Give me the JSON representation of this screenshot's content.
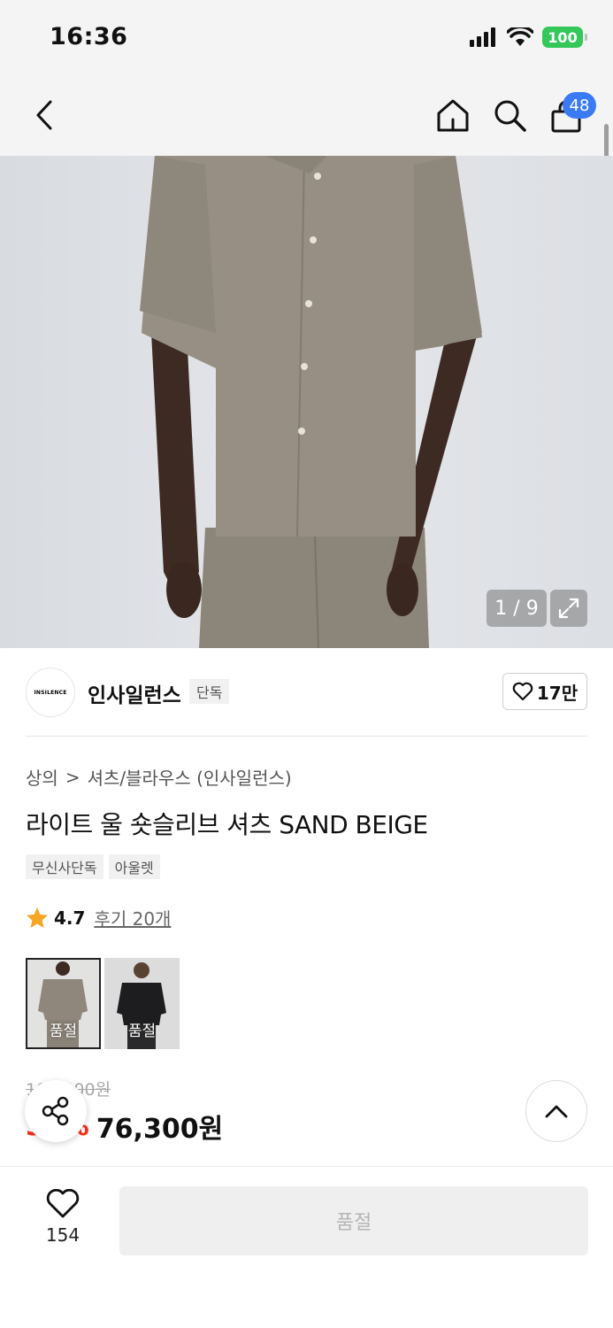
{
  "status_bar": {
    "time": "16:36",
    "battery": "100"
  },
  "nav": {
    "cart_count": "48",
    "icons": [
      "back-arrow-icon",
      "home-icon",
      "search-icon",
      "shopping-bag-icon"
    ]
  },
  "gallery": {
    "counter": "1 / 9"
  },
  "brand": {
    "logo_text": "INSILENCE",
    "name": "인사일런스",
    "tag": "단독",
    "like_count": "17만"
  },
  "product": {
    "breadcrumb": [
      "상의",
      "셔츠/블라우스 (인사일런스)"
    ],
    "title": "라이트 울 숏슬리브 셔츠 SAND BEIGE",
    "tags": [
      "무신사단독",
      "아울렛"
    ],
    "rating": "4.7",
    "review_link": "후기 20개",
    "color_options": [
      {
        "label": "품절",
        "color": "#8f877c"
      },
      {
        "label": "품절",
        "color": "#1d1d1f"
      }
    ],
    "original_price": "109,000원",
    "sale_price": "76,300원",
    "discount": "30%"
  },
  "bottom": {
    "wish_count": "154",
    "buy_label": "품절"
  },
  "colors": {
    "accent_blue": "#3a7bf5",
    "discount_red": "#ff2d1a",
    "battery_green": "#34c759"
  }
}
